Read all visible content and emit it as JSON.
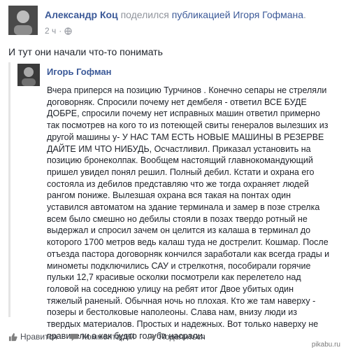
{
  "post": {
    "author": "Александр Коц",
    "shared_verb": "поделился",
    "shared_target": "публикацией Игоря Гофмана",
    "shared_suffix": ".",
    "time": "2 ч",
    "separator": "·",
    "text": "И тут они начали что-то понимать"
  },
  "shared_post": {
    "author": "Игорь Гофман",
    "body": "Вчера приперся на позицию Турчинов . Конечно сепары не стреляли договорняк. Спросили почему нет дембеля - ответил ВСЕ БУДЕ ДОБРЕ, спросили почему нет исправных машин ответил примерно так посмотрев на кого то из потеющей свиты генералов вылезших из другой машины у- У НАС ТАМ ЕСТЬ НОВЫЕ МАШИНЫ В РЕЗЕРВЕ ДАЙТЕ ИМ ЧТО НИБУДЬ, Осчастливил. Приказал установить на позицию бронеколпак. Вообщем настоящий главнокомандующий пришел увидел понял решил. Полный дебил. Кстати и охрана его состояла из дебилов представляю что же тогда охраняет людей рангом пониже. Вылезшая охрана вся такая на понтах один уставился автоматом на здание терминала и замер в позе стрелка всем было смешно но дебилы стояли в позах твердо ротный не выдержал и спросил зачем он целится из калаша в терминал до которого 1700 метров ведь калаш туда не дострелит. Кошмар. После отъезда пастора договорняк кончился заработали как всегда грады и минометы подключились САУ и стрелкотня, пособирали горячие пульки 12,7 красивые осколки посмотрели как перелетело над головой на соседнюю улицу на ребят итог Двое убитых один тяжелый раненый. Обычная ночь но плохая. Кто же там наверху - позеры и бестолковые наполеоны. Слава нам, внизу люди из твердых материалов. Простых и надежных. Вот только наверху не правители а как будто голуби насрали."
  },
  "actions": {
    "like": "Нравится",
    "comment": "Комментарий",
    "share": "Поделиться"
  },
  "watermark": "pikabu.ru",
  "icons": [
    "globe-icon",
    "like-icon",
    "comment-icon",
    "share-icon"
  ],
  "colors": {
    "link": "#3b5998",
    "muted": "#90949c",
    "text": "#1d2129"
  }
}
